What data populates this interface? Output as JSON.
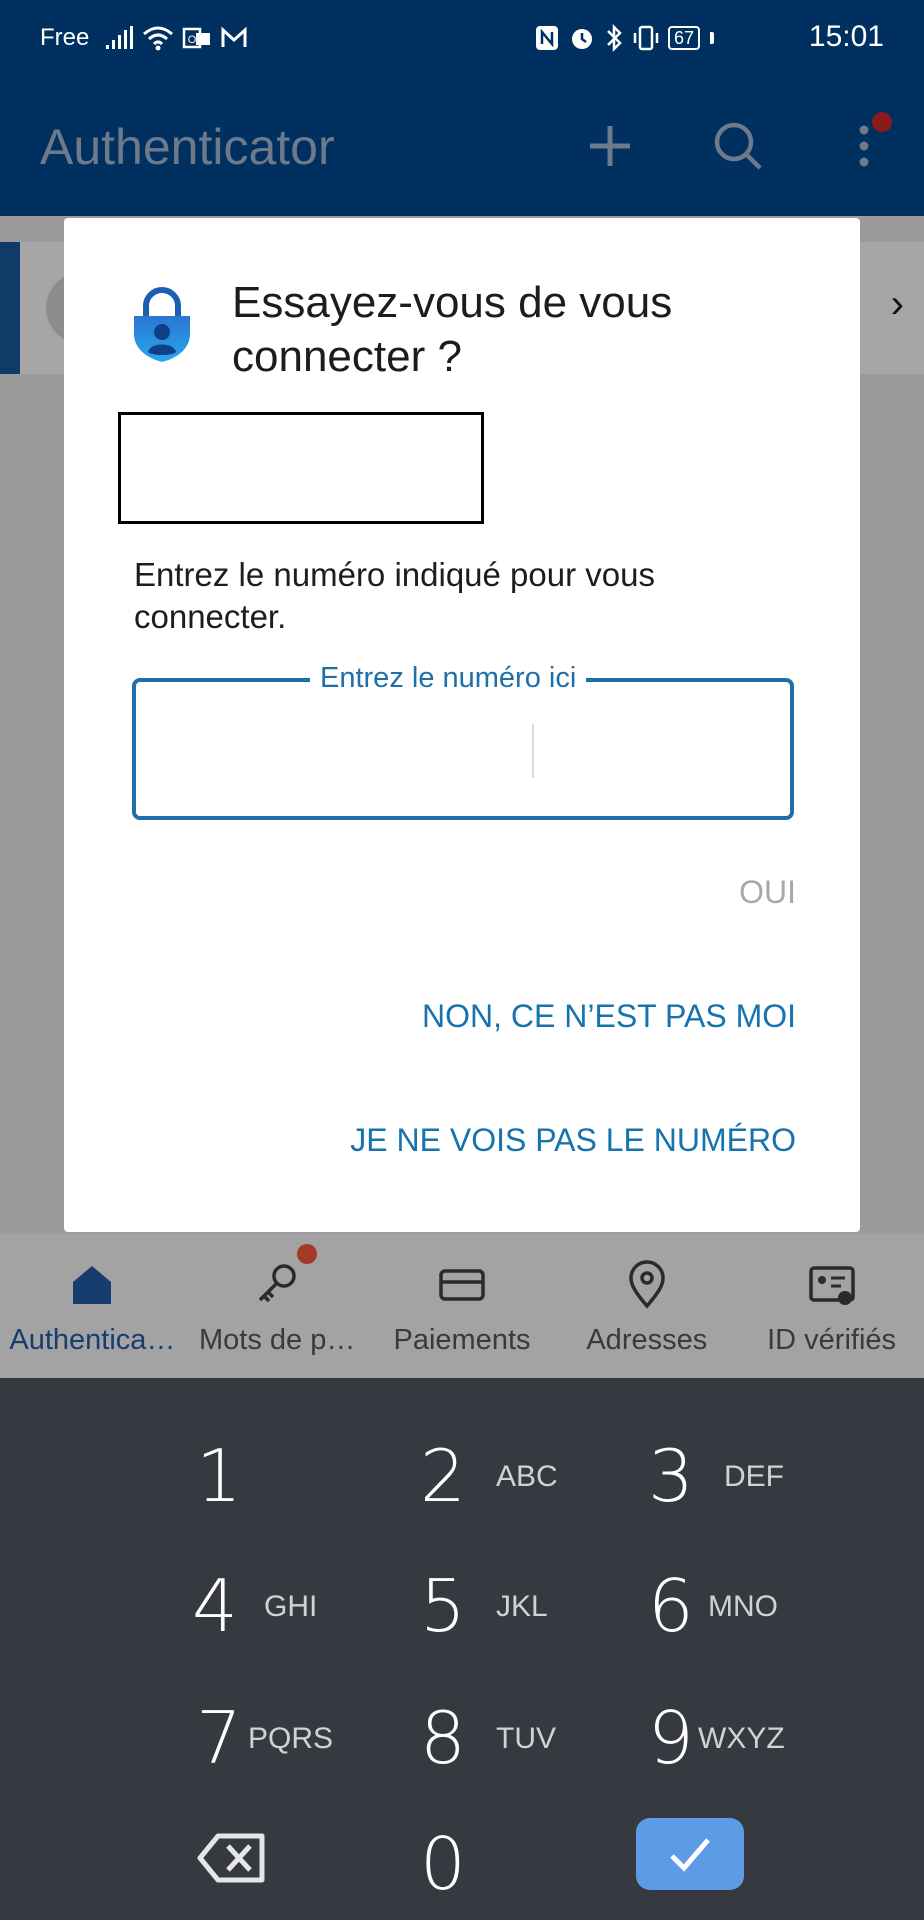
{
  "status_bar": {
    "carrier": "Free",
    "battery": "67",
    "time": "15:01"
  },
  "app_bar": {
    "title": "Authenticator"
  },
  "dialog": {
    "title": "Essayez-vous de vous connecter ?",
    "instruction": "Entrez le numéro indiqué pour vous connecter.",
    "input_label": "Entrez le numéro ici",
    "input_value": "",
    "yes_label": "OUI",
    "no_label": "NON, CE N’EST PAS MOI",
    "no_number_label": "JE NE VOIS PAS LE NUMÉRO"
  },
  "bottom_nav": {
    "items": [
      {
        "label": "Authentica…",
        "icon": "home-icon",
        "active": true
      },
      {
        "label": "Mots de p…",
        "icon": "key-icon",
        "badge": true
      },
      {
        "label": "Paiements",
        "icon": "card-icon"
      },
      {
        "label": "Adresses",
        "icon": "location-icon"
      },
      {
        "label": "ID vérifiés",
        "icon": "verified-id-icon"
      }
    ]
  },
  "keypad": {
    "keys": [
      {
        "digit": "1",
        "letters": ""
      },
      {
        "digit": "2",
        "letters": "ABC"
      },
      {
        "digit": "3",
        "letters": "DEF"
      },
      {
        "digit": "4",
        "letters": "GHI"
      },
      {
        "digit": "5",
        "letters": "JKL"
      },
      {
        "digit": "6",
        "letters": "MNO"
      },
      {
        "digit": "7",
        "letters": "PQRS"
      },
      {
        "digit": "8",
        "letters": "TUV"
      },
      {
        "digit": "9",
        "letters": "WXYZ"
      },
      {
        "digit": "0",
        "letters": ""
      }
    ]
  },
  "colors": {
    "app_bar": "#00305f",
    "accent": "#1673ae",
    "confirm_key": "#5d9be6",
    "keypad_bg": "#36393f"
  }
}
